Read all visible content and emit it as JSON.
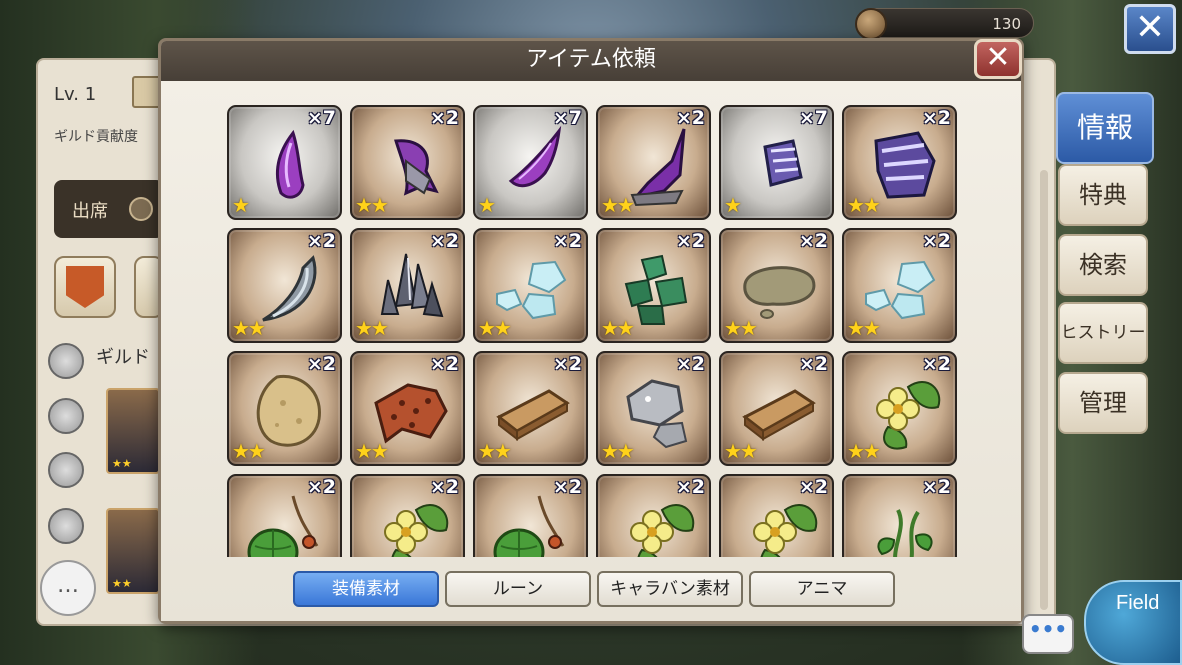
{
  "resource": {
    "value": "130",
    "icon": "coin-icon"
  },
  "background_panel": {
    "level": "Lv. 1",
    "contribution_label": "ギルド貢献度",
    "attend_label": "出席",
    "guild_label": "ギルド",
    "member_stars": [
      "★★",
      "★★"
    ]
  },
  "right_tabs": [
    {
      "label": "情報",
      "active": true
    },
    {
      "label": "特典",
      "active": false
    },
    {
      "label": "検索",
      "active": false
    },
    {
      "label": "ヒストリー",
      "active": false
    },
    {
      "label": "管理",
      "active": false
    }
  ],
  "field_button": {
    "label": "Field"
  },
  "chat": {
    "dots": "•••"
  },
  "dialog": {
    "title": "アイテム依頼",
    "close_symbol": "✕",
    "items": [
      {
        "qty": "×7",
        "stars": "★",
        "bg": "g",
        "icon": "purple-shard-icon"
      },
      {
        "qty": "×2",
        "stars": "★★",
        "bg": "b",
        "icon": "purple-horn-icon"
      },
      {
        "qty": "×7",
        "stars": "★",
        "bg": "g",
        "icon": "purple-fang-icon"
      },
      {
        "qty": "×2",
        "stars": "★★",
        "bg": "b",
        "icon": "purple-crystal-spike-icon"
      },
      {
        "qty": "×7",
        "stars": "★",
        "bg": "g",
        "icon": "purple-scale-icon"
      },
      {
        "qty": "×2",
        "stars": "★★",
        "bg": "b",
        "icon": "purple-scales-pile-icon"
      },
      {
        "qty": "×2",
        "stars": "★★",
        "bg": "b",
        "icon": "gray-crescent-stone-icon"
      },
      {
        "qty": "×2",
        "stars": "★★",
        "bg": "b",
        "icon": "dark-crystal-cluster-icon"
      },
      {
        "qty": "×2",
        "stars": "★★",
        "bg": "b",
        "icon": "ice-chunks-icon"
      },
      {
        "qty": "×2",
        "stars": "★★",
        "bg": "b",
        "icon": "green-ore-icon"
      },
      {
        "qty": "×2",
        "stars": "★★",
        "bg": "b",
        "icon": "mud-puddle-icon"
      },
      {
        "qty": "×2",
        "stars": "★★",
        "bg": "b",
        "icon": "ice-chunks-icon"
      },
      {
        "qty": "×2",
        "stars": "★★",
        "bg": "b",
        "icon": "sand-stone-icon"
      },
      {
        "qty": "×2",
        "stars": "★★",
        "bg": "b",
        "icon": "coral-rock-icon"
      },
      {
        "qty": "×2",
        "stars": "★★",
        "bg": "b",
        "icon": "wood-planks-icon"
      },
      {
        "qty": "×2",
        "stars": "★★",
        "bg": "b",
        "icon": "silver-ore-icon"
      },
      {
        "qty": "×2",
        "stars": "★★",
        "bg": "b",
        "icon": "wood-planks-icon"
      },
      {
        "qty": "×2",
        "stars": "★★",
        "bg": "b",
        "icon": "yellow-flower-herb-icon"
      },
      {
        "qty": "×2",
        "stars": "★★",
        "bg": "b",
        "icon": "green-gourd-vine-icon"
      },
      {
        "qty": "×2",
        "stars": "★★",
        "bg": "b",
        "icon": "yellow-flower-herb-icon"
      },
      {
        "qty": "×2",
        "stars": "★★",
        "bg": "b",
        "icon": "green-gourd-vine-icon"
      },
      {
        "qty": "×2",
        "stars": "★★",
        "bg": "b",
        "icon": "yellow-flower-herb-icon"
      },
      {
        "qty": "×2",
        "stars": "★★",
        "bg": "b",
        "icon": "yellow-flower-herb-icon"
      },
      {
        "qty": "×2",
        "stars": "★★",
        "bg": "b",
        "icon": "green-vine-icon"
      }
    ],
    "tabs": [
      {
        "label": "装備素材",
        "active": true
      },
      {
        "label": "ルーン",
        "active": false
      },
      {
        "label": "キャラバン素材",
        "active": false
      },
      {
        "label": "アニマ",
        "active": false
      }
    ]
  },
  "colors": {
    "accent_blue": "#3a77d8",
    "star_gold": "#ffd21a",
    "header_brown": "#5e5449",
    "close_red": "#c26560"
  }
}
